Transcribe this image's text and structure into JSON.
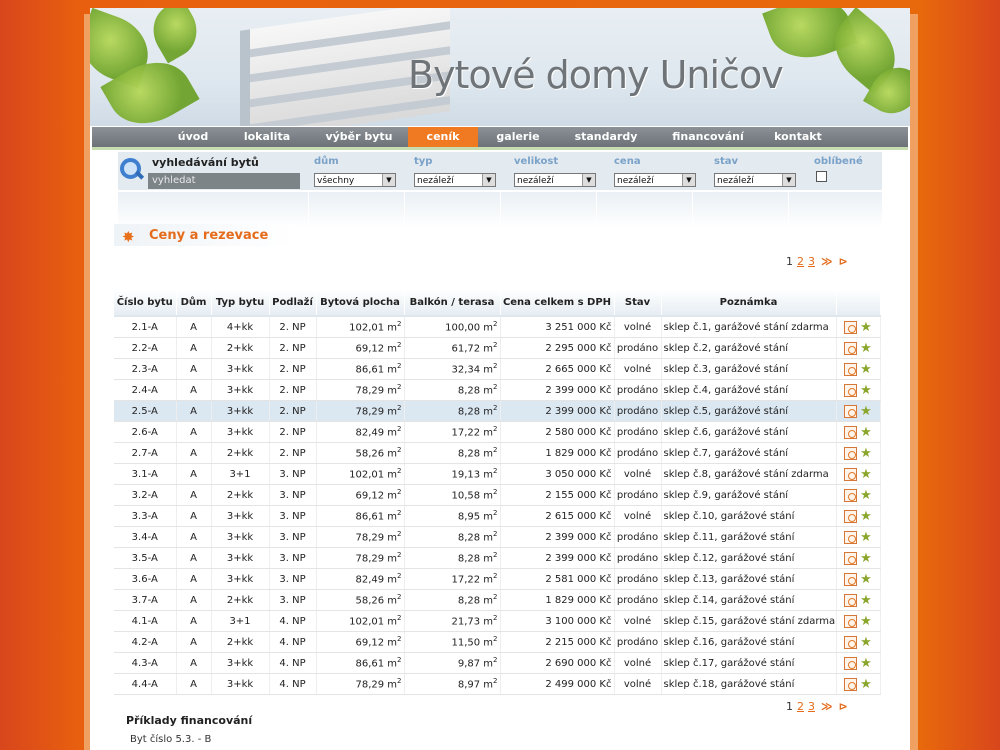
{
  "site_title": "Bytové domy Uničov",
  "nav": [
    {
      "label": "úvod",
      "active": false
    },
    {
      "label": "lokalita",
      "active": false
    },
    {
      "label": "výběr bytu",
      "active": false
    },
    {
      "label": "ceník",
      "active": true
    },
    {
      "label": "galerie",
      "active": false
    },
    {
      "label": "standardy",
      "active": false
    },
    {
      "label": "financování",
      "active": false
    },
    {
      "label": "kontakt",
      "active": false
    }
  ],
  "search": {
    "title": "vyhledávání bytů",
    "button": "vyhledat",
    "filters": [
      {
        "label": "dům",
        "value": "všechny"
      },
      {
        "label": "typ",
        "value": "nezáleží"
      },
      {
        "label": "velikost",
        "value": "nezáleží"
      },
      {
        "label": "cena",
        "value": "nezáleží"
      },
      {
        "label": "stav",
        "value": "nezáleží"
      }
    ],
    "favorite_label": "oblíbené"
  },
  "section_title": "Ceny a rezevace",
  "pager": {
    "current": "1",
    "pages": [
      "2",
      "3"
    ],
    "next": "≫",
    "last": "⊳"
  },
  "columns": [
    "Číslo bytu",
    "Dům",
    "Typ bytu",
    "Podlaží",
    "Bytová plocha",
    "Balkón / terasa",
    "Cena celkem s DPH",
    "Stav",
    "Poznámka"
  ],
  "rows": [
    {
      "num": "2.1-A",
      "house": "A",
      "type": "4+kk",
      "floor": "2. NP",
      "area": "102,01 m",
      "balcony": "100,00 m",
      "price": "3 251 000 Kč",
      "state": "volné",
      "note": "sklep č.1, garážové stání zdarma"
    },
    {
      "num": "2.2-A",
      "house": "A",
      "type": "2+kk",
      "floor": "2. NP",
      "area": "69,12 m",
      "balcony": "61,72 m",
      "price": "2 295 000 Kč",
      "state": "prodáno",
      "note": "sklep č.2, garážové stání"
    },
    {
      "num": "2.3-A",
      "house": "A",
      "type": "3+kk",
      "floor": "2. NP",
      "area": "86,61 m",
      "balcony": "32,34 m",
      "price": "2 665 000 Kč",
      "state": "volné",
      "note": "sklep č.3, garážové stání"
    },
    {
      "num": "2.4-A",
      "house": "A",
      "type": "3+kk",
      "floor": "2. NP",
      "area": "78,29 m",
      "balcony": "8,28 m",
      "price": "2 399 000 Kč",
      "state": "prodáno",
      "note": "sklep č.4, garážové stání"
    },
    {
      "num": "2.5-A",
      "house": "A",
      "type": "3+kk",
      "floor": "2. NP",
      "area": "78,29 m",
      "balcony": "8,28 m",
      "price": "2 399 000 Kč",
      "state": "prodáno",
      "note": "sklep č.5, garážové stání",
      "highlight": true
    },
    {
      "num": "2.6-A",
      "house": "A",
      "type": "3+kk",
      "floor": "2. NP",
      "area": "82,49 m",
      "balcony": "17,22 m",
      "price": "2 580 000 Kč",
      "state": "prodáno",
      "note": "sklep č.6, garážové stání"
    },
    {
      "num": "2.7-A",
      "house": "A",
      "type": "2+kk",
      "floor": "2. NP",
      "area": "58,26 m",
      "balcony": "8,28 m",
      "price": "1 829 000 Kč",
      "state": "prodáno",
      "note": "sklep č.7, garážové stání"
    },
    {
      "num": "3.1-A",
      "house": "A",
      "type": "3+1",
      "floor": "3. NP",
      "area": "102,01 m",
      "balcony": "19,13 m",
      "price": "3 050 000 Kč",
      "state": "volné",
      "note": "sklep č.8, garážové stání zdarma"
    },
    {
      "num": "3.2-A",
      "house": "A",
      "type": "2+kk",
      "floor": "3. NP",
      "area": "69,12 m",
      "balcony": "10,58 m",
      "price": "2 155 000 Kč",
      "state": "prodáno",
      "note": "sklep č.9, garážové stání"
    },
    {
      "num": "3.3-A",
      "house": "A",
      "type": "3+kk",
      "floor": "3. NP",
      "area": "86,61 m",
      "balcony": "8,95 m",
      "price": "2 615 000 Kč",
      "state": "volné",
      "note": "sklep č.10, garážové stání"
    },
    {
      "num": "3.4-A",
      "house": "A",
      "type": "3+kk",
      "floor": "3. NP",
      "area": "78,29 m",
      "balcony": "8,28 m",
      "price": "2 399 000 Kč",
      "state": "prodáno",
      "note": "sklep č.11, garážové stání"
    },
    {
      "num": "3.5-A",
      "house": "A",
      "type": "3+kk",
      "floor": "3. NP",
      "area": "78,29 m",
      "balcony": "8,28 m",
      "price": "2 399 000 Kč",
      "state": "prodáno",
      "note": "sklep č.12, garážové stání"
    },
    {
      "num": "3.6-A",
      "house": "A",
      "type": "3+kk",
      "floor": "3. NP",
      "area": "82,49 m",
      "balcony": "17,22 m",
      "price": "2 581 000 Kč",
      "state": "prodáno",
      "note": "sklep č.13, garážové stání"
    },
    {
      "num": "3.7-A",
      "house": "A",
      "type": "2+kk",
      "floor": "3. NP",
      "area": "58,26 m",
      "balcony": "8,28 m",
      "price": "1 829 000 Kč",
      "state": "prodáno",
      "note": "sklep č.14, garážové stání"
    },
    {
      "num": "4.1-A",
      "house": "A",
      "type": "3+1",
      "floor": "4. NP",
      "area": "102,01 m",
      "balcony": "21,73 m",
      "price": "3 100 000 Kč",
      "state": "volné",
      "note": "sklep č.15, garážové stání zdarma"
    },
    {
      "num": "4.2-A",
      "house": "A",
      "type": "2+kk",
      "floor": "4. NP",
      "area": "69,12 m",
      "balcony": "11,50 m",
      "price": "2 215 000 Kč",
      "state": "prodáno",
      "note": "sklep č.16, garážové stání"
    },
    {
      "num": "4.3-A",
      "house": "A",
      "type": "3+kk",
      "floor": "4. NP",
      "area": "86,61 m",
      "balcony": "9,87 m",
      "price": "2 690 000 Kč",
      "state": "volné",
      "note": "sklep č.17, garážové stání"
    },
    {
      "num": "4.4-A",
      "house": "A",
      "type": "3+kk",
      "floor": "4. NP",
      "area": "78,29 m",
      "balcony": "8,97 m",
      "price": "2 499 000 Kč",
      "state": "volné",
      "note": "sklep č.18, garážové stání"
    }
  ],
  "unit_sup": "2",
  "financing": {
    "title": "Příklady financování",
    "text": "Byt číslo 5.3. - B"
  }
}
